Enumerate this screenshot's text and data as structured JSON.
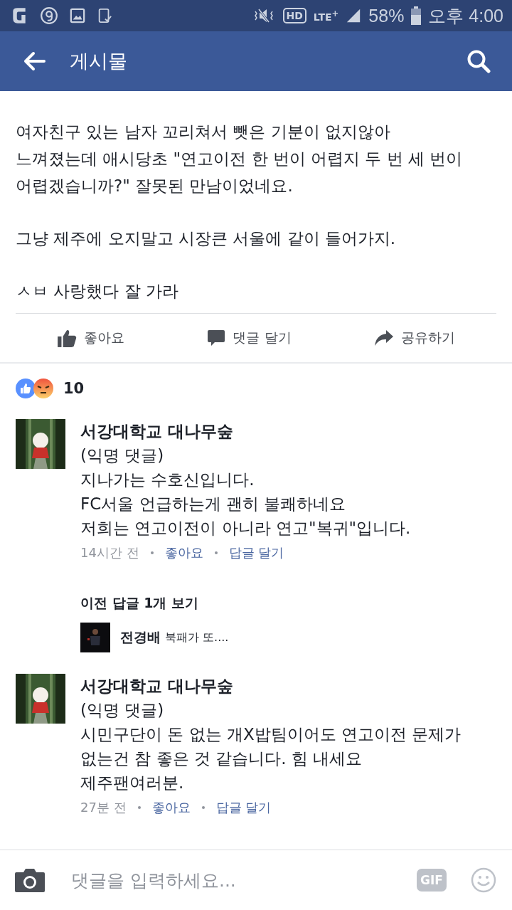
{
  "status_bar": {
    "hd": "HD",
    "network": "LTE$^{+}$",
    "battery": "58%",
    "time": "오후 4:00"
  },
  "header": {
    "title": "게시물"
  },
  "post": {
    "paragraphs": [
      "여자친구 있는 남자 꼬리쳐서 뺏은 기분이 없지않아\n느껴졌는데 애시당초 \"연고이전 한 번이 어렵지 두 번 세 번이\n어렵겠습니까?\"  잘못된 만남이었네요.",
      "그냥 제주에 오지말고 시장큰 서울에 같이 들어가지.",
      "ㅅㅂ 사랑했다 잘 가라"
    ]
  },
  "actions": [
    {
      "kind": "like",
      "label": "좋아요"
    },
    {
      "kind": "comment",
      "label": "댓글 달기"
    },
    {
      "kind": "share",
      "label": "공유하기"
    }
  ],
  "reactions": {
    "count": "10"
  },
  "comments": [
    {
      "author": "서강대학교 대나무숲",
      "text": "(익명 댓글)\n지나가는 수호신입니다.\nFC서울 언급하는게 괜히 불쾌하네요\n저희는 연고이전이 아니라 연고\"복귀\"입니다.",
      "time": "14시간 전",
      "like": "좋아요",
      "reply": "답글 달기",
      "previous_replies": {
        "link": "이전 답글 1개 보기",
        "author": "전경배",
        "text": "북패가 또...."
      }
    },
    {
      "author": "서강대학교 대나무숲",
      "text": "(익명 댓글)\n시민구단이 돈 없는 개X밥팀이어도 연고이전 문제가\n없는건 참 좋은 것 같습니다. 힘 내세요\n제주팬여러분.",
      "time": "27분 전",
      "like": "좋아요",
      "reply": "답글 달기"
    }
  ],
  "composer": {
    "placeholder": "댓글을 입력하세요...",
    "gif": "GIF"
  }
}
